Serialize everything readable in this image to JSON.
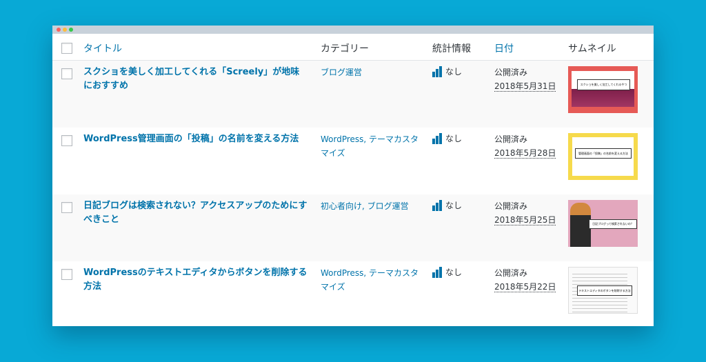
{
  "header": {
    "title": "タイトル",
    "category": "カテゴリー",
    "stats": "統計情報",
    "date": "日付",
    "thumbnail": "サムネイル"
  },
  "rows": [
    {
      "title": "スクショを美しく加工してくれる「Screely」が地味におすすめ",
      "categories": "ブログ運営",
      "stats": "なし",
      "status": "公開済み",
      "date": "2018年5月31日",
      "thumb_text": "スクショを美しく加工してくれるやつ"
    },
    {
      "title": "WordPress管理画面の「投稿」の名前を変える方法",
      "categories": "WordPress, テーマカスタマイズ",
      "stats": "なし",
      "status": "公開済み",
      "date": "2018年5月28日",
      "thumb_text": "管理画面の「投稿」の名前を変える方法"
    },
    {
      "title": "日記ブログは検索されない？アクセスアップのためにすべきこと",
      "categories": "初心者向け, ブログ運営",
      "stats": "なし",
      "status": "公開済み",
      "date": "2018年5月25日",
      "thumb_text": "日記ブログって検索されないの？"
    },
    {
      "title": "WordPressのテキストエディタからボタンを削除する方法",
      "categories": "WordPress, テーマカスタマイズ",
      "stats": "なし",
      "status": "公開済み",
      "date": "2018年5月22日",
      "thumb_text": "テキストエディタのボタンを削除する方法"
    }
  ],
  "colors": {
    "link": "#0073aa",
    "background": "#08a9d6"
  }
}
